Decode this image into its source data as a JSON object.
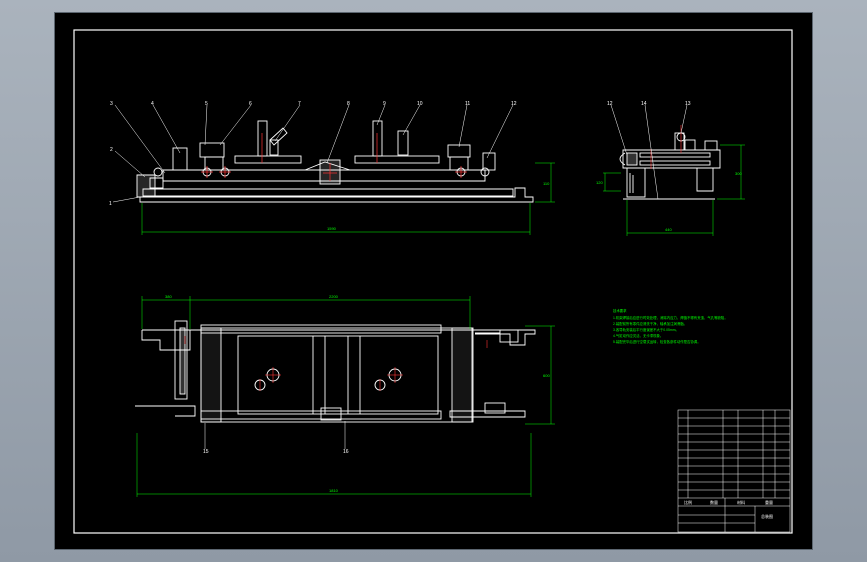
{
  "viewer": {
    "background_top": "#aab3bd",
    "background_bottom": "#8f99a5"
  },
  "drawing": {
    "sheet_color": "#000000",
    "line_color": "#ffffff",
    "dimension_color": "#00ff00",
    "centerline_color": "#ff3333",
    "front_view": {
      "part_labels": [
        "1",
        "2",
        "3",
        "4",
        "5",
        "6",
        "7",
        "8",
        "9",
        "10",
        "11",
        "12"
      ],
      "overall_length": "1590",
      "height": "110"
    },
    "side_view": {
      "part_labels": [
        "12",
        "14",
        "13"
      ],
      "width": "440",
      "height": "300",
      "base_height": "120"
    },
    "plan_view": {
      "dims": [
        "380",
        "2200",
        "600",
        "1810"
      ],
      "section_labels": [
        "15",
        "16"
      ]
    },
    "notes": {
      "title": "技术要求",
      "lines": [
        "1.机架焊接后应进行时效处理，消除内应力，焊缝不得有夹渣、气孔等缺陷。",
        "2.装配前所有零件应清洗干净，轴承加注润滑脂。",
        "3.各导轨安装后平行度误差不大于0.05mm。",
        "4.气缸动作应灵活，无卡滞现象。",
        "5.装配完毕后进行空载试运转，检查各部件动作是否协调。"
      ]
    },
    "title_block": {
      "name": "总装图",
      "footer": [
        "比例",
        "数量",
        "材料",
        "重量"
      ]
    }
  }
}
